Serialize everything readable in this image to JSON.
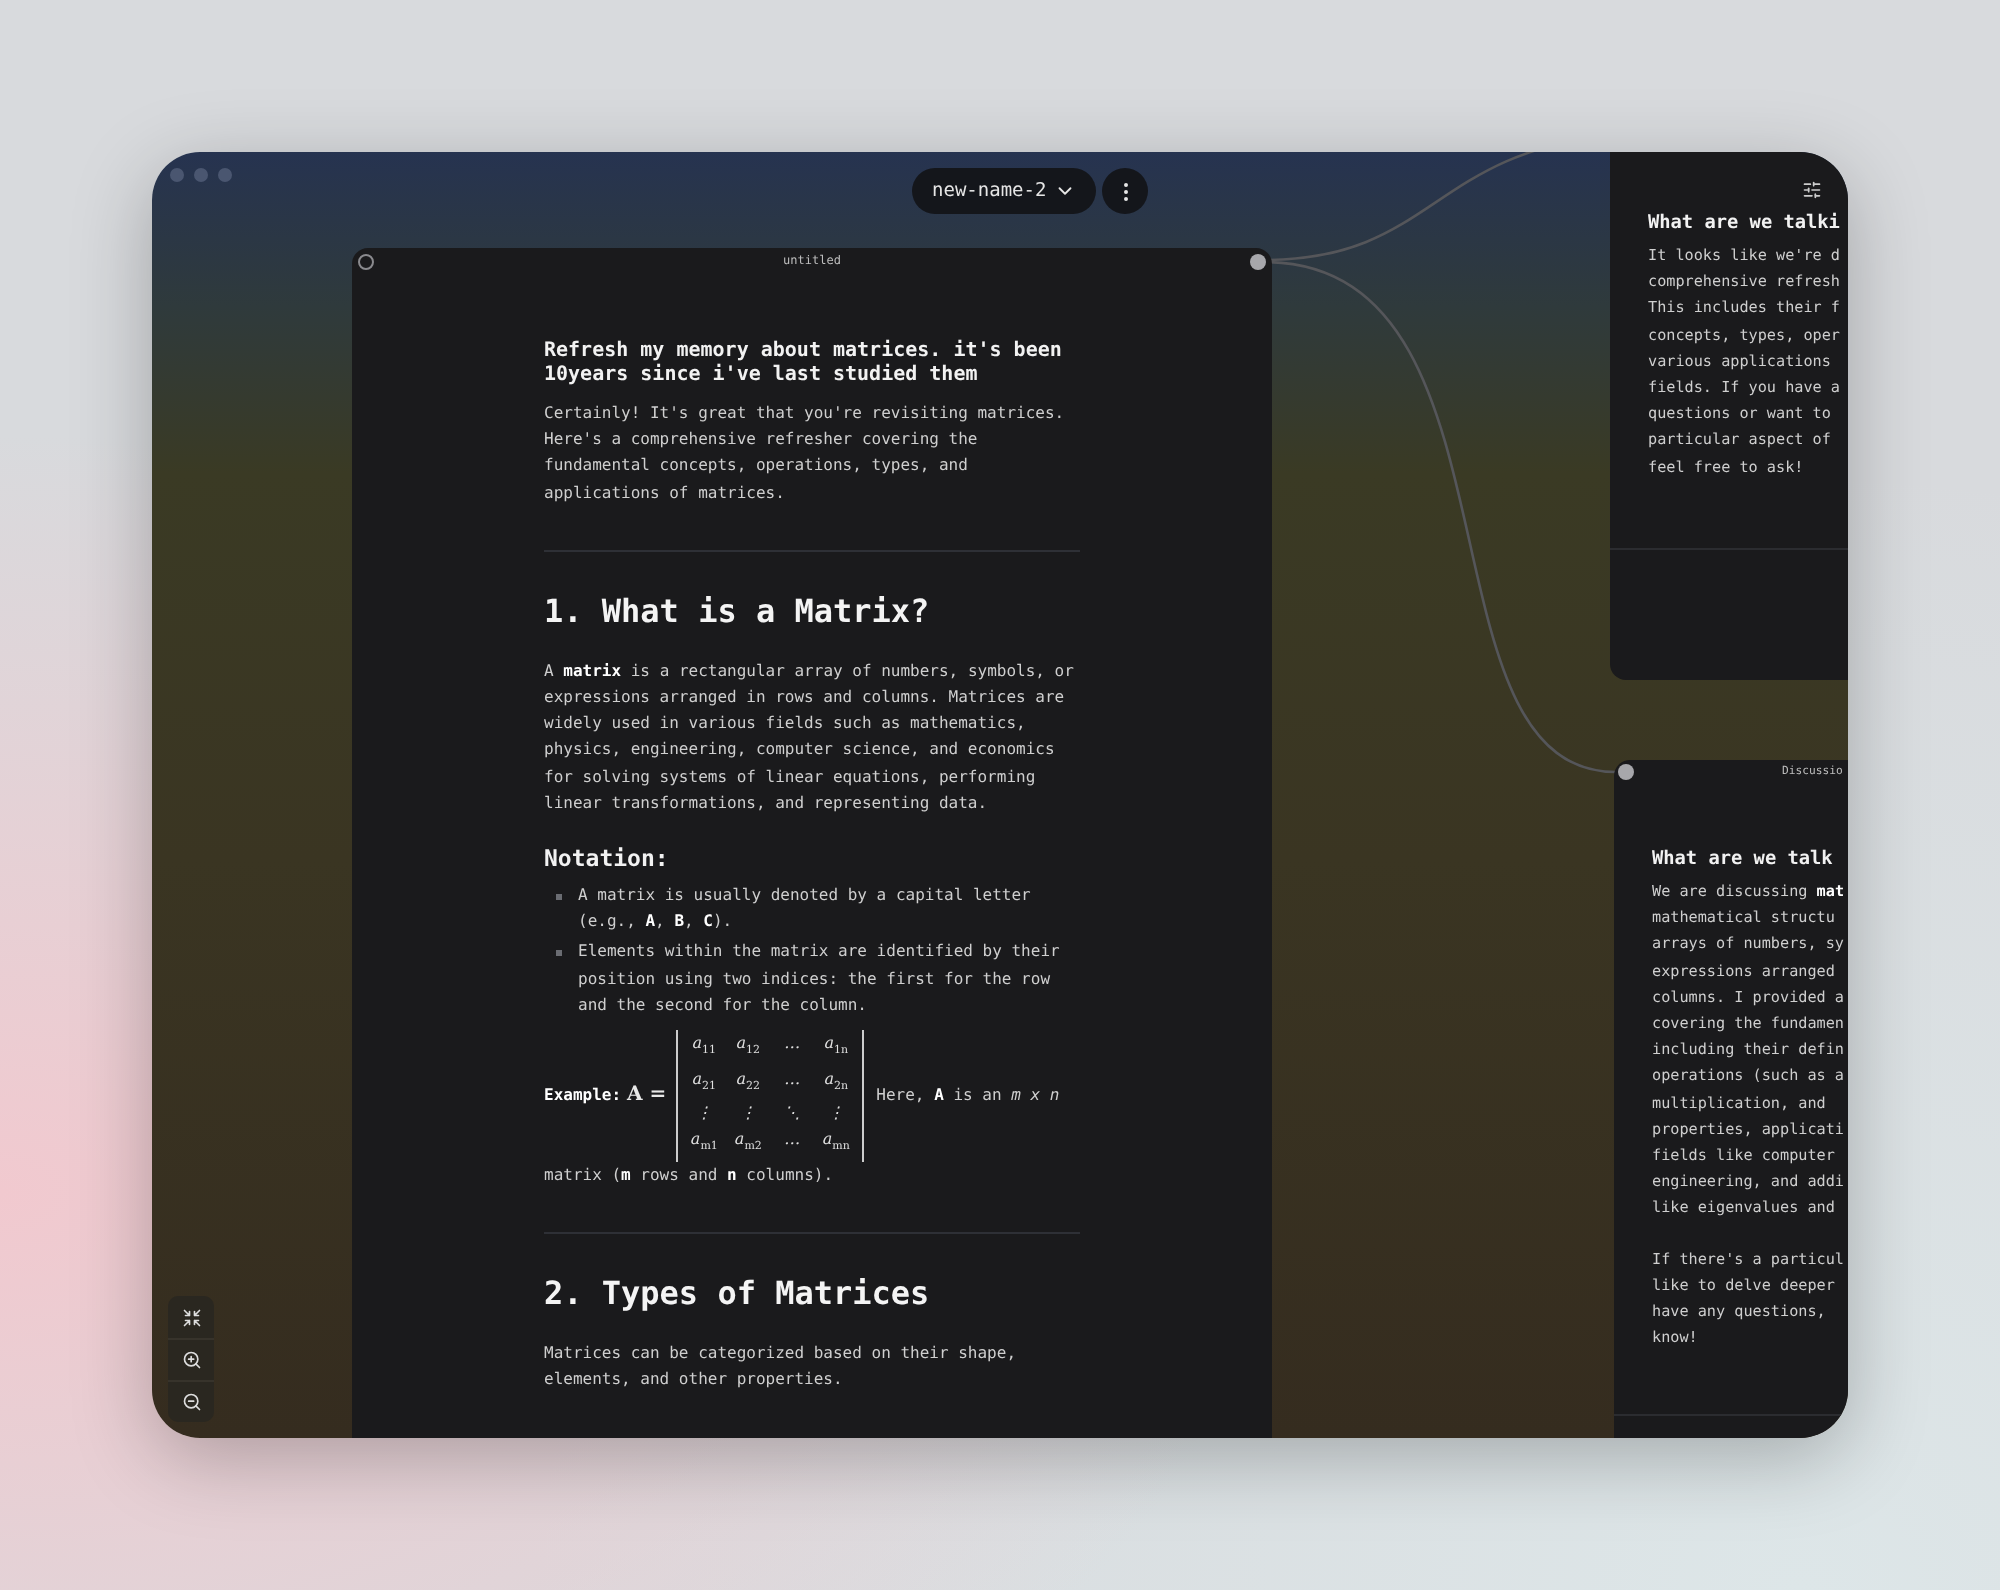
{
  "toolbar": {
    "project_name": "new-name-2"
  },
  "main_node": {
    "title": "untitled",
    "blocks": [
      {
        "kind": "prompt",
        "text": "Refresh my memory about matrices. it's been 10years since i've last studied them"
      },
      {
        "kind": "paragraph",
        "text": "Certainly! It's great that you're revisiting matrices. Here's a comprehensive refresher covering the fundamental concepts, operations, types, and applications of matrices."
      },
      {
        "kind": "divider"
      },
      {
        "kind": "heading",
        "text": "1. What is a Matrix?"
      },
      {
        "kind": "paragraph",
        "text": "A **matrix** is a rectangular array of numbers, symbols, or expressions arranged in rows and columns. Matrices are widely used in various fields such as mathematics, physics, engineering, computer science, and economics for solving systems of linear equations, performing linear transformations, and representing data."
      },
      {
        "kind": "subheading",
        "text": "Notation:"
      },
      {
        "kind": "bullets",
        "items": [
          "A matrix is usually denoted by a capital letter (e.g., **A**, **B**, **C**).",
          "Elements within the matrix are identified by their position using two indices: the first for the row and the second for the column."
        ]
      },
      {
        "kind": "example",
        "label": "Example:",
        "symbol": "A =",
        "matrix": [
          [
            "a$_{11}$",
            "a$_{12}$",
            "…",
            "a$_{1n}$"
          ],
          [
            "a$_{21}$",
            "a$_{22}$",
            "…",
            "a$_{2n}$"
          ],
          [
            "⋮",
            "⋮",
            "⋱",
            "⋮"
          ],
          [
            "a$_{m1}$",
            "a$_{m2}$",
            "…",
            "a$_{mn}$"
          ]
        ],
        "text": "Here, **A** is an *m x n*",
        "text_below": "matrix (**m** rows and **n** columns)."
      },
      {
        "kind": "divider"
      },
      {
        "kind": "heading",
        "text": "2. Types of Matrices"
      },
      {
        "kind": "paragraph",
        "text": "Matrices can be categorized based on their shape, elements, and other properties."
      }
    ]
  },
  "side_nodes": [
    {
      "title": "What are we talki",
      "paragraphs": [
        [
          "It looks like we're d",
          "comprehensive refresh",
          "This includes their f",
          "concepts, types, oper",
          "various applications",
          "fields. If you have a",
          "questions or want to",
          "particular aspect of",
          "feel free to ask!"
        ]
      ]
    },
    {
      "label": "Discussio",
      "title": "What are we talk",
      "paragraphs": [
        [
          "We are discussing **mat**",
          "mathematical structu",
          "arrays of numbers, sy",
          "expressions arranged",
          "columns. I provided a",
          "covering the fundamen",
          "including their defin",
          "operations (such as a",
          "multiplication, and",
          "properties, applicati",
          "fields like computer",
          "engineering, and addi",
          "like eigenvalues and"
        ],
        [
          "If there's a particul",
          "like to delve deeper",
          "have any questions,",
          "know!"
        ]
      ]
    }
  ]
}
